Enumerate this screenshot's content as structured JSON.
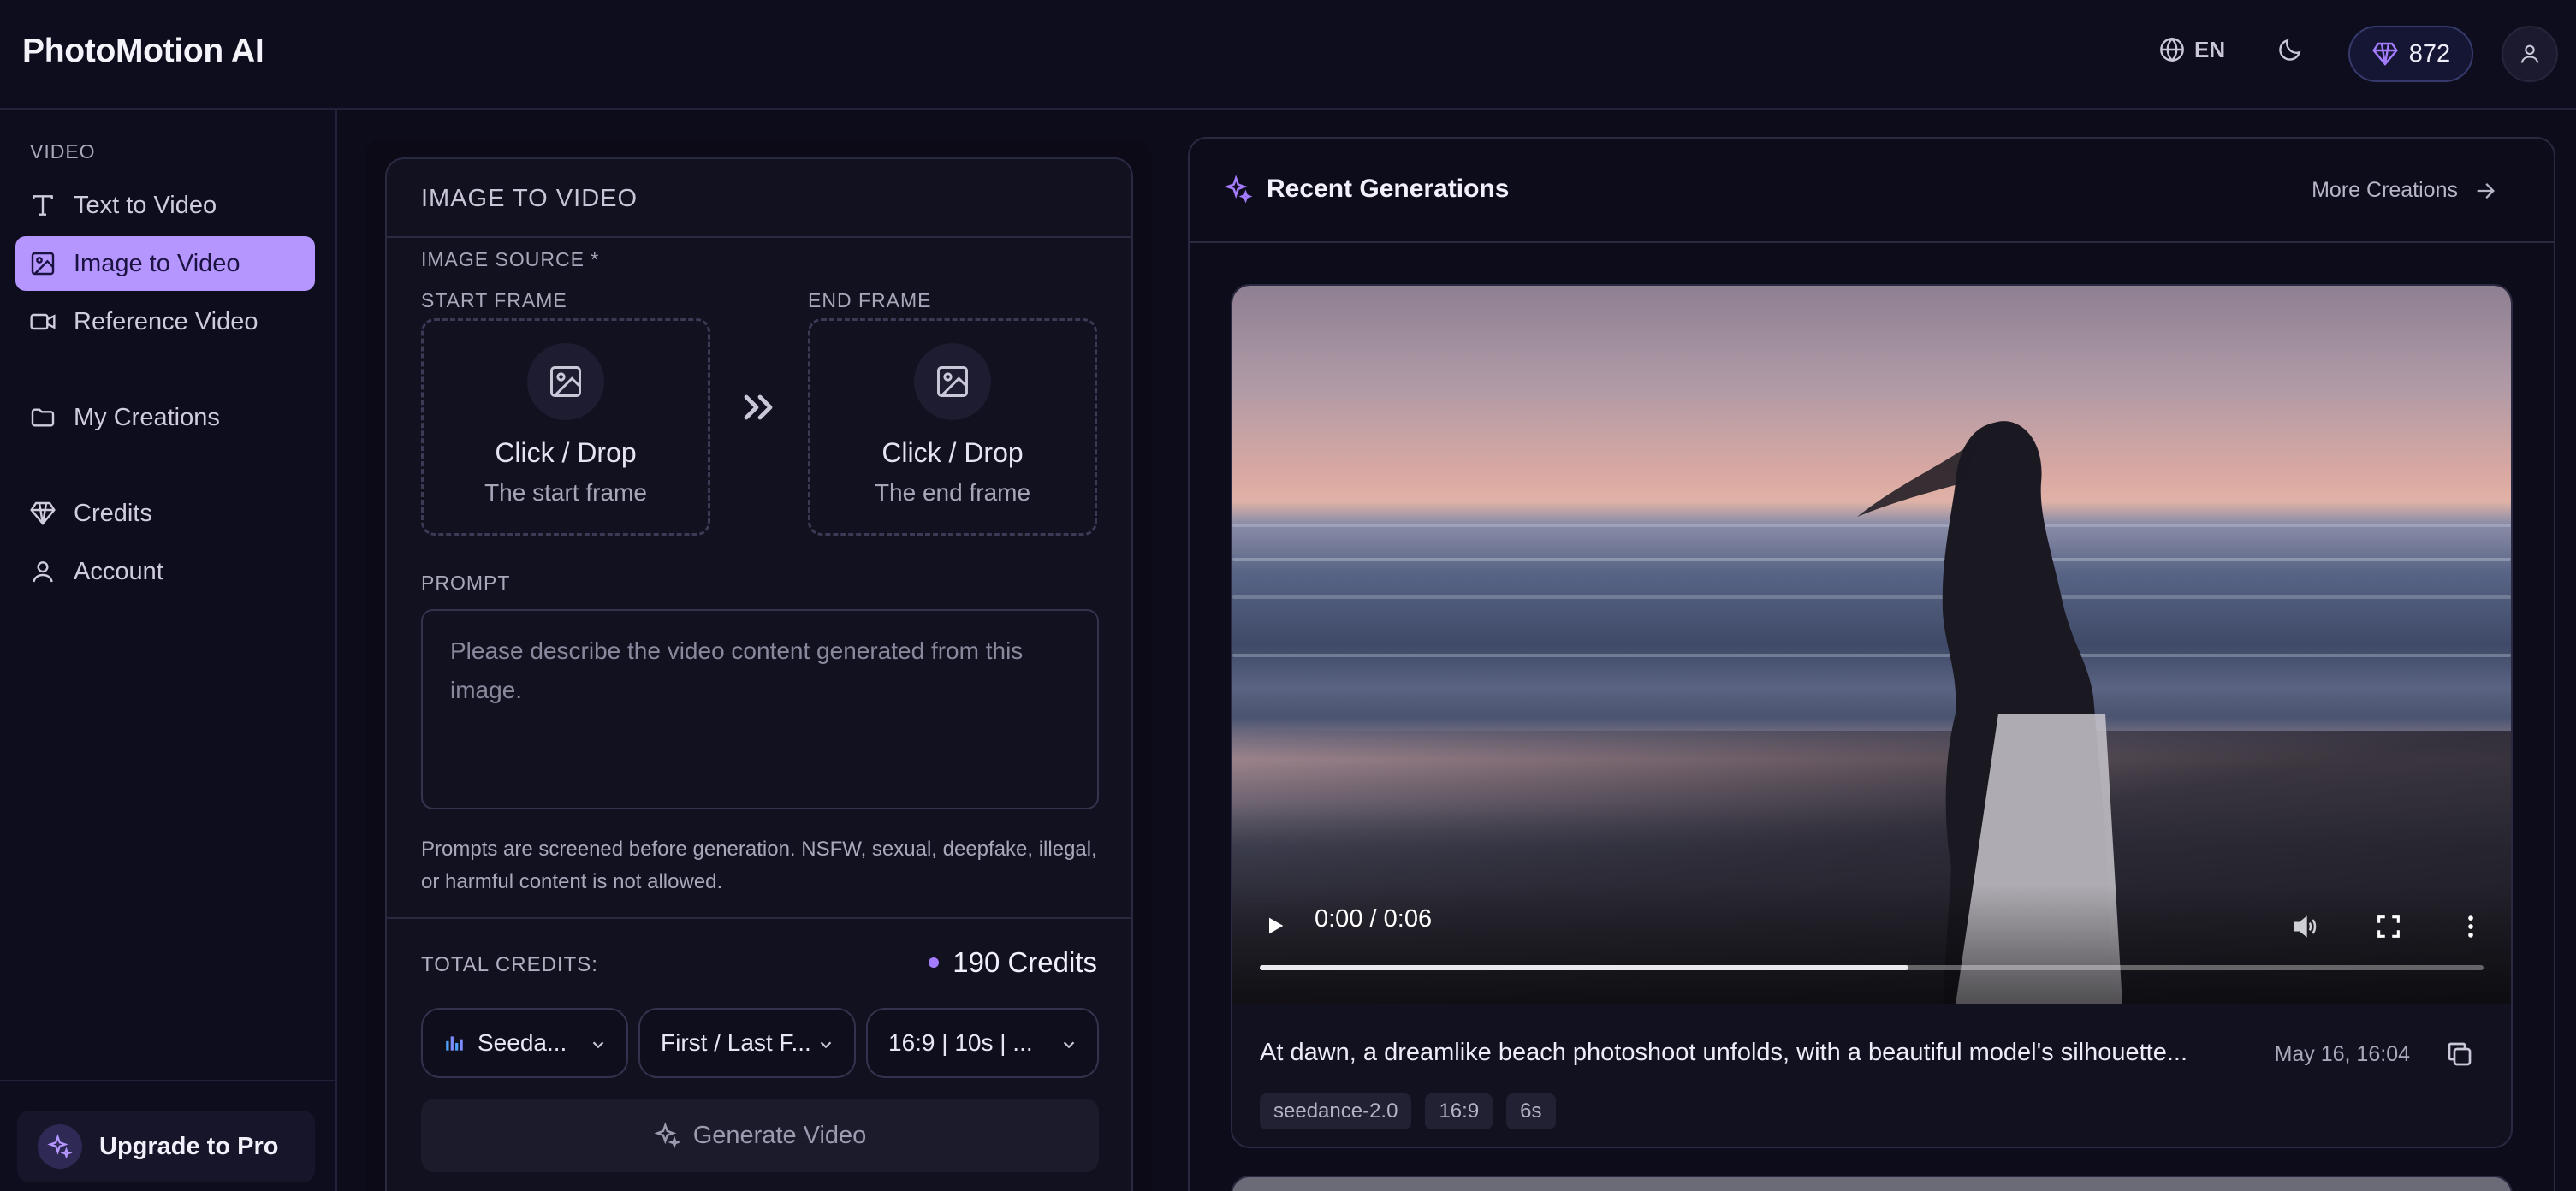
{
  "brand": "PhotoMotion AI",
  "header": {
    "language": "EN",
    "credits": "872"
  },
  "sidebar": {
    "section_video": "VIDEO",
    "items": [
      {
        "label": "Text to Video",
        "icon": "text-icon"
      },
      {
        "label": "Image to Video",
        "icon": "image-icon",
        "active": true
      },
      {
        "label": "Reference Video",
        "icon": "video-camera-icon"
      },
      {
        "label": "My Creations",
        "icon": "folder-icon"
      },
      {
        "label": "Credits",
        "icon": "gem-icon"
      },
      {
        "label": "Account",
        "icon": "user-icon"
      }
    ],
    "upgrade_label": "Upgrade to Pro"
  },
  "form": {
    "title": "IMAGE TO VIDEO",
    "image_source_label": "IMAGE SOURCE *",
    "start_frame": {
      "label": "START FRAME",
      "title": "Click / Drop",
      "subtitle": "The start frame"
    },
    "end_frame": {
      "label": "END FRAME",
      "title": "Click / Drop",
      "subtitle": "The end frame"
    },
    "prompt_label": "PROMPT",
    "prompt_placeholder": "Please describe the video content generated from this image.",
    "notice": "Prompts are screened before generation. NSFW, sexual, deepfake, illegal, or harmful content is not allowed.",
    "total_credits_label": "TOTAL CREDITS:",
    "total_credits_value": "190 Credits",
    "selects": {
      "model": "Seeda...",
      "mode": "First / Last F...",
      "format": "16:9 | 10s | ..."
    },
    "generate_label": "Generate Video"
  },
  "recent": {
    "title": "Recent Generations",
    "more_label": "More Creations",
    "item": {
      "time_current": "0:00",
      "time_separator": "/",
      "time_total": "0:06",
      "progress": 0.53,
      "caption": "At dawn, a dreamlike beach photoshoot unfolds, with a beautiful model's silhouette...",
      "date": "May 16, 16:04",
      "tags": [
        "seedance-2.0",
        "16:9",
        "6s"
      ]
    }
  },
  "colors": {
    "accent": "#b596ff",
    "background": "#0d0c1a",
    "panel": "#121120"
  }
}
